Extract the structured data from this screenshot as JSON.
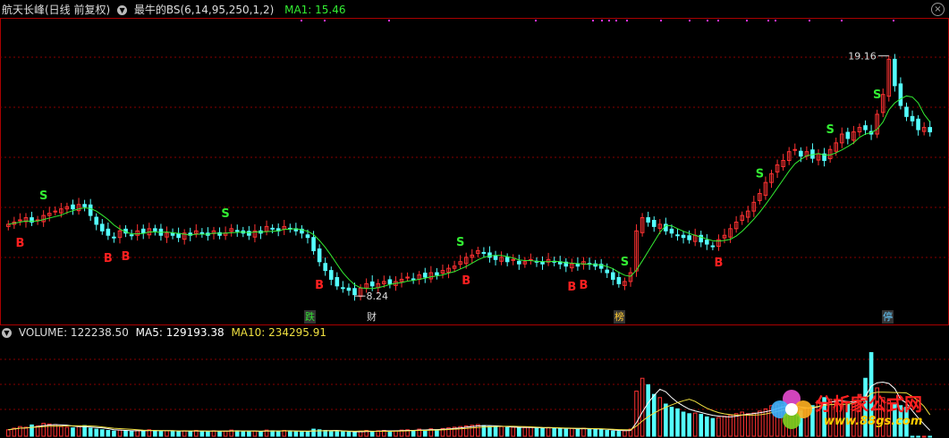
{
  "header": {
    "stock": "航天长峰(日线 前复权)",
    "indicator": "最牛的BS(6,14,95,250,1,2)",
    "ma1": "MA1: 15.46",
    "ma1_color": "#33ee33",
    "stock_color": "#dddddd",
    "indicator_color": "#dddddd"
  },
  "volume_header": {
    "volume": "VOLUME: 122238.50",
    "ma5": "MA5: 129193.38",
    "ma10": "MA10: 234295.91",
    "ma5_color": "#ffffff",
    "ma10_color": "#f0e040"
  },
  "events": [
    {
      "label": "跌",
      "color": "#33dd33",
      "bg": "#333"
    },
    {
      "label": "财",
      "color": "#dddddd",
      "bg": "#000"
    },
    {
      "label": "榜",
      "color": "#ffcc33",
      "bg": "#333"
    },
    {
      "label": "停",
      "color": "#66ccff",
      "bg": "#333"
    }
  ],
  "watermark": {
    "cn": "分析家公式网",
    "url": "www.88gs.com"
  },
  "chart_data": {
    "type": "candlestick",
    "ylim": [
      7.8,
      20.8
    ],
    "low_annotation": "8.24",
    "high_annotation": "19.16",
    "close": [
      11.5,
      11.6,
      11.7,
      11.8,
      11.6,
      11.7,
      11.9,
      12.0,
      12.1,
      12.2,
      12.3,
      12.2,
      12.4,
      12.3,
      11.9,
      11.5,
      11.2,
      11.0,
      10.9,
      11.2,
      11.1,
      11.0,
      11.2,
      11.1,
      11.3,
      11.2,
      11.0,
      11.1,
      11.0,
      10.9,
      11.1,
      11.0,
      11.2,
      11.1,
      11.0,
      11.2,
      11.0,
      11.1,
      11.3,
      11.2,
      11.1,
      11.0,
      11.2,
      11.1,
      11.4,
      11.3,
      11.2,
      11.4,
      11.3,
      11.2,
      11.1,
      10.9,
      10.3,
      9.8,
      9.4,
      9.0,
      8.7,
      8.6,
      8.5,
      8.3,
      8.6,
      8.8,
      8.7,
      8.8,
      8.9,
      8.8,
      8.9,
      9.0,
      9.1,
      9.0,
      9.2,
      9.1,
      9.3,
      9.2,
      9.4,
      9.5,
      9.6,
      9.8,
      10.0,
      10.1,
      10.3,
      10.2,
      10.0,
      9.9,
      10.0,
      9.8,
      9.9,
      9.7,
      9.8,
      9.9,
      9.8,
      9.7,
      9.9,
      9.8,
      9.7,
      9.6,
      9.7,
      9.6,
      9.8,
      9.7,
      9.6,
      9.5,
      9.3,
      9.0,
      8.8,
      8.9,
      9.3,
      11.2,
      11.8,
      11.6,
      11.4,
      11.5,
      11.2,
      11.1,
      11.0,
      10.9,
      10.8,
      11.0,
      10.7,
      10.6,
      10.5,
      10.8,
      11.0,
      11.3,
      11.6,
      11.9,
      12.1,
      12.5,
      12.9,
      13.4,
      13.8,
      14.2,
      14.4,
      14.8,
      14.9,
      14.6,
      14.8,
      14.5,
      14.7,
      14.4,
      14.9,
      15.2,
      15.6,
      15.4,
      15.7,
      15.9,
      15.8,
      15.6,
      16.5,
      17.4,
      19.0,
      17.8,
      16.9,
      16.4,
      16.2,
      15.8,
      15.9,
      15.7
    ],
    "s_signals": [
      6,
      37,
      77,
      105,
      128,
      140,
      148
    ],
    "b_signals": [
      2,
      17,
      20,
      53,
      78,
      96,
      98,
      121
    ],
    "volume_ylim": [
      0,
      300000
    ],
    "volume": [
      20000,
      25000,
      30000,
      28000,
      35000,
      32000,
      40000,
      38000,
      36000,
      30000,
      28000,
      26000,
      30000,
      33000,
      25000,
      22000,
      20000,
      18000,
      16000,
      19000,
      17000,
      15000,
      18000,
      16000,
      20000,
      18000,
      15000,
      17000,
      16000,
      14000,
      17000,
      15000,
      18000,
      16000,
      14000,
      17000,
      15000,
      16000,
      19000,
      17000,
      15000,
      14000,
      16000,
      15000,
      19000,
      17000,
      15000,
      18000,
      16000,
      15000,
      14000,
      13000,
      22000,
      20000,
      18000,
      16000,
      15000,
      14000,
      13000,
      12000,
      16000,
      18000,
      15000,
      17000,
      18000,
      16000,
      17000,
      19000,
      20000,
      18000,
      22000,
      19000,
      23000,
      20000,
      24000,
      26000,
      28000,
      30000,
      32000,
      34000,
      36000,
      33000,
      30000,
      28000,
      30000,
      27000,
      28000,
      25000,
      27000,
      28000,
      26000,
      24000,
      27000,
      25000,
      23000,
      22000,
      24000,
      22000,
      25000,
      23000,
      21000,
      20000,
      18000,
      16000,
      15000,
      17000,
      22000,
      140000,
      180000,
      160000,
      130000,
      120000,
      100000,
      90000,
      85000,
      75000,
      70000,
      72000,
      68000,
      60000,
      55000,
      58000,
      62000,
      65000,
      70000,
      75000,
      70000,
      72000,
      78000,
      85000,
      95000,
      100000,
      98000,
      90000,
      85000,
      80000,
      88000,
      95000,
      110000,
      120000,
      115000,
      105000,
      100000,
      98000,
      110000,
      130000,
      180000,
      260000,
      150000,
      120000,
      110000,
      100000,
      95000,
      90000
    ]
  }
}
